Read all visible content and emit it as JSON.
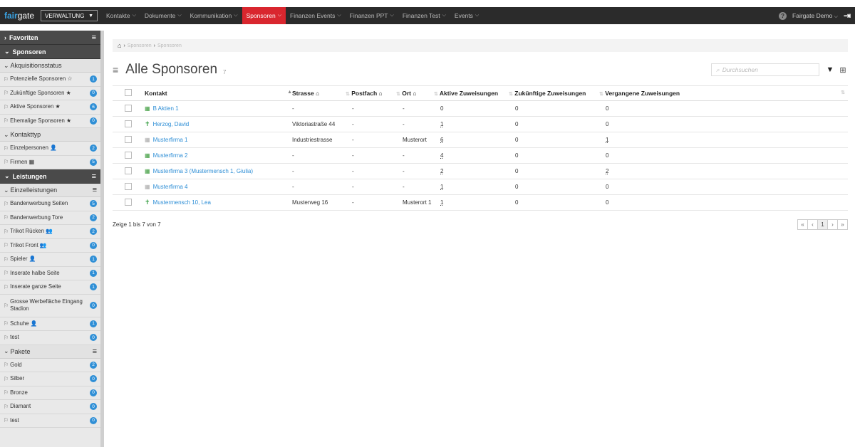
{
  "header": {
    "logo_prefix": "fair",
    "logo_suffix": "gate",
    "org_select": "VERWALTUNG",
    "nav": [
      "Kontakte",
      "Dokumente",
      "Kommunikation",
      "Sponsoren",
      "Finanzen Events",
      "Finanzen PPT",
      "Finanzen Test",
      "Events"
    ],
    "user": "Fairgate Demo",
    "help": "?"
  },
  "sidebar": {
    "favoriten": "Favoriten",
    "sponsoren": "Sponsoren",
    "akquisition": "Akquisitionsstatus",
    "akq_items": [
      {
        "label": "Potenzielle Sponsoren ☆",
        "count": "1"
      },
      {
        "label": "Zukünftige Sponsoren ★",
        "count": "0"
      },
      {
        "label": "Aktive Sponsoren ★",
        "count": "6"
      },
      {
        "label": "Ehemalige Sponsoren ★",
        "count": "0"
      }
    ],
    "kontakttyp": "Kontakttyp",
    "kt_items": [
      {
        "label": "Einzelpersonen 👤",
        "count": "2"
      },
      {
        "label": "Firmen ▦",
        "count": "5"
      }
    ],
    "leistungen": "Leistungen",
    "einzelleistungen": "Einzelleistungen",
    "el_items": [
      {
        "label": "Bandenwerbung Seiten",
        "count": "5"
      },
      {
        "label": "Bandenwerbung Tore",
        "count": "2"
      },
      {
        "label": "Trikot Rücken 👥",
        "count": "2"
      },
      {
        "label": "Trikot Front 👥",
        "count": "0"
      },
      {
        "label": "Spieler 👤",
        "count": "1"
      },
      {
        "label": "Inserate halbe Seite",
        "count": "1"
      },
      {
        "label": "Inserate ganze Seite",
        "count": "1"
      },
      {
        "label": "Grosse Werbefläche Eingang Stadion",
        "count": "0"
      },
      {
        "label": "Schuhe 👤",
        "count": "1"
      },
      {
        "label": "test",
        "count": "0"
      }
    ],
    "pakete": "Pakete",
    "pk_items": [
      {
        "label": "Gold",
        "count": "2"
      },
      {
        "label": "Silber",
        "count": "0"
      },
      {
        "label": "Bronze",
        "count": "0"
      },
      {
        "label": "Diamant",
        "count": "0"
      },
      {
        "label": "test",
        "count": "0"
      }
    ]
  },
  "main": {
    "breadcrumb": [
      "Sponsoren",
      "Sponsoren"
    ],
    "title": "Alle Sponsoren",
    "count": "7",
    "search_placeholder": "Durchsuchen",
    "columns": [
      "Kontakt",
      "Strasse",
      "Postfach",
      "Ort",
      "Aktive Zuweisungen",
      "Zukünftige Zuweisungen",
      "Vergangene Zuweisungen"
    ],
    "rows": [
      {
        "kontakt": "B Aktien 1",
        "type": "firm",
        "strasse": "-",
        "postfach": "-",
        "ort": "-",
        "aktiv": "0",
        "zukunft": "0",
        "vergangen": "0"
      },
      {
        "kontakt": "Herzog, David",
        "type": "person",
        "strasse": "Viktoriastraße 44",
        "postfach": "-",
        "ort": "-",
        "aktiv": "1",
        "zukunft": "0",
        "vergangen": "0"
      },
      {
        "kontakt": "Musterfirma 1",
        "type": "firm-gray",
        "strasse": "Industriestrasse",
        "postfach": "-",
        "ort": "Musterort",
        "aktiv": "6",
        "zukunft": "0",
        "vergangen": "1"
      },
      {
        "kontakt": "Musterfirma 2",
        "type": "firm",
        "strasse": "-",
        "postfach": "-",
        "ort": "-",
        "aktiv": "4",
        "zukunft": "0",
        "vergangen": "0"
      },
      {
        "kontakt": "Musterfirma 3 (Mustermensch 1, Giulia)",
        "type": "firm",
        "strasse": "-",
        "postfach": "-",
        "ort": "-",
        "aktiv": "2",
        "zukunft": "0",
        "vergangen": "2"
      },
      {
        "kontakt": "Musterfirma 4",
        "type": "firm-gray",
        "strasse": "-",
        "postfach": "-",
        "ort": "-",
        "aktiv": "1",
        "zukunft": "0",
        "vergangen": "0"
      },
      {
        "kontakt": "Mustermensch 10, Lea",
        "type": "person",
        "strasse": "Musterweg 16",
        "postfach": "-",
        "ort": "Musterort 1",
        "aktiv": "1",
        "zukunft": "0",
        "vergangen": "0"
      }
    ],
    "footer_text": "Zeige 1 bis 7 von 7",
    "pager": [
      "«",
      "‹",
      "1",
      "›",
      "»"
    ]
  },
  "colors": {
    "accent": "#d9262e",
    "link": "#2f8fd6",
    "badge": "#2f8fd6",
    "topbar": "#2b2b2b"
  },
  "icons": [
    "home-icon",
    "filter-icon",
    "columns-icon",
    "logout-icon",
    "help-icon",
    "bookmark-icon"
  ]
}
